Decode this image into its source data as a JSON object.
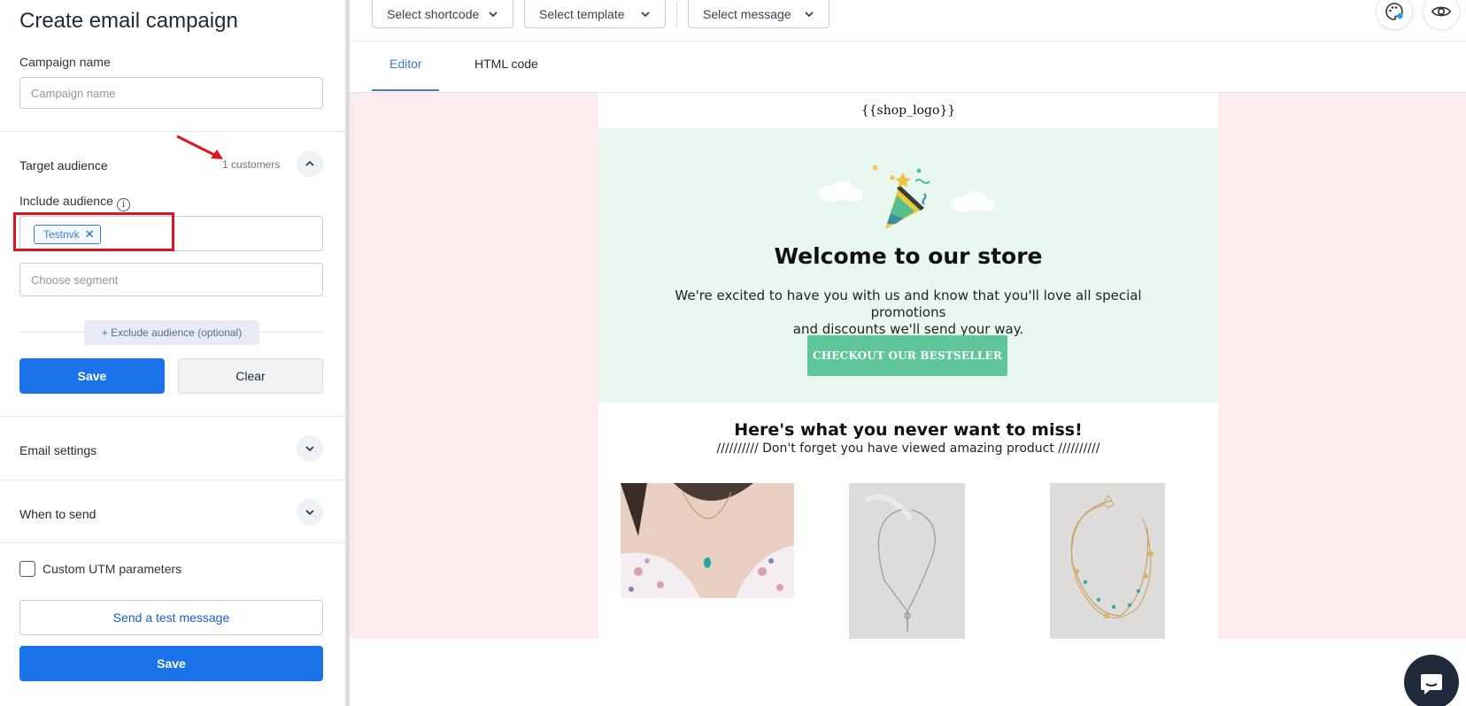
{
  "sidebar": {
    "title": "Create email campaign",
    "campaign_name": {
      "label": "Campaign name",
      "placeholder": "Campaign name",
      "value": ""
    },
    "target_audience": {
      "title": "Target audience",
      "count": "1 customers",
      "include_label": "Include audience",
      "tags": [
        "Testnvk"
      ],
      "segment_placeholder": "Choose segment",
      "exclude_button": "+ Exclude audience (optional)",
      "save_label": "Save",
      "clear_label": "Clear"
    },
    "email_settings": {
      "title": "Email settings"
    },
    "when_to_send": {
      "title": "When to send"
    },
    "utm": {
      "label": "Custom UTM parameters",
      "checked": false
    },
    "test_message_label": "Send a test message",
    "save_label": "Save"
  },
  "toolbar": {
    "shortcode": "Select shortcode",
    "template": "Select template",
    "message": "Select message"
  },
  "tabs": [
    {
      "label": "Editor",
      "active": true
    },
    {
      "label": "HTML code",
      "active": false
    }
  ],
  "email": {
    "logo_placeholder": "{{shop_logo}}",
    "hero_title": "Welcome to our store",
    "hero_body_line1": "We're excited to have you with us and know that you'll love all special promotions",
    "hero_body_line2": "and discounts we'll send your way.",
    "cta_label": "CHECKOUT OUR BESTSELLER",
    "section_title": "Here's what you never want to miss!",
    "section_subtitle": "////////// Don't forget you have viewed amazing product //////////"
  },
  "colors": {
    "primary": "#1a73e8",
    "accent_blue": "#3f7ad9",
    "hero_bg": "#e9f7f1",
    "cta_green": "#5ec69a",
    "canvas_bg": "#fcecec",
    "highlight_red": "#e0141e"
  }
}
